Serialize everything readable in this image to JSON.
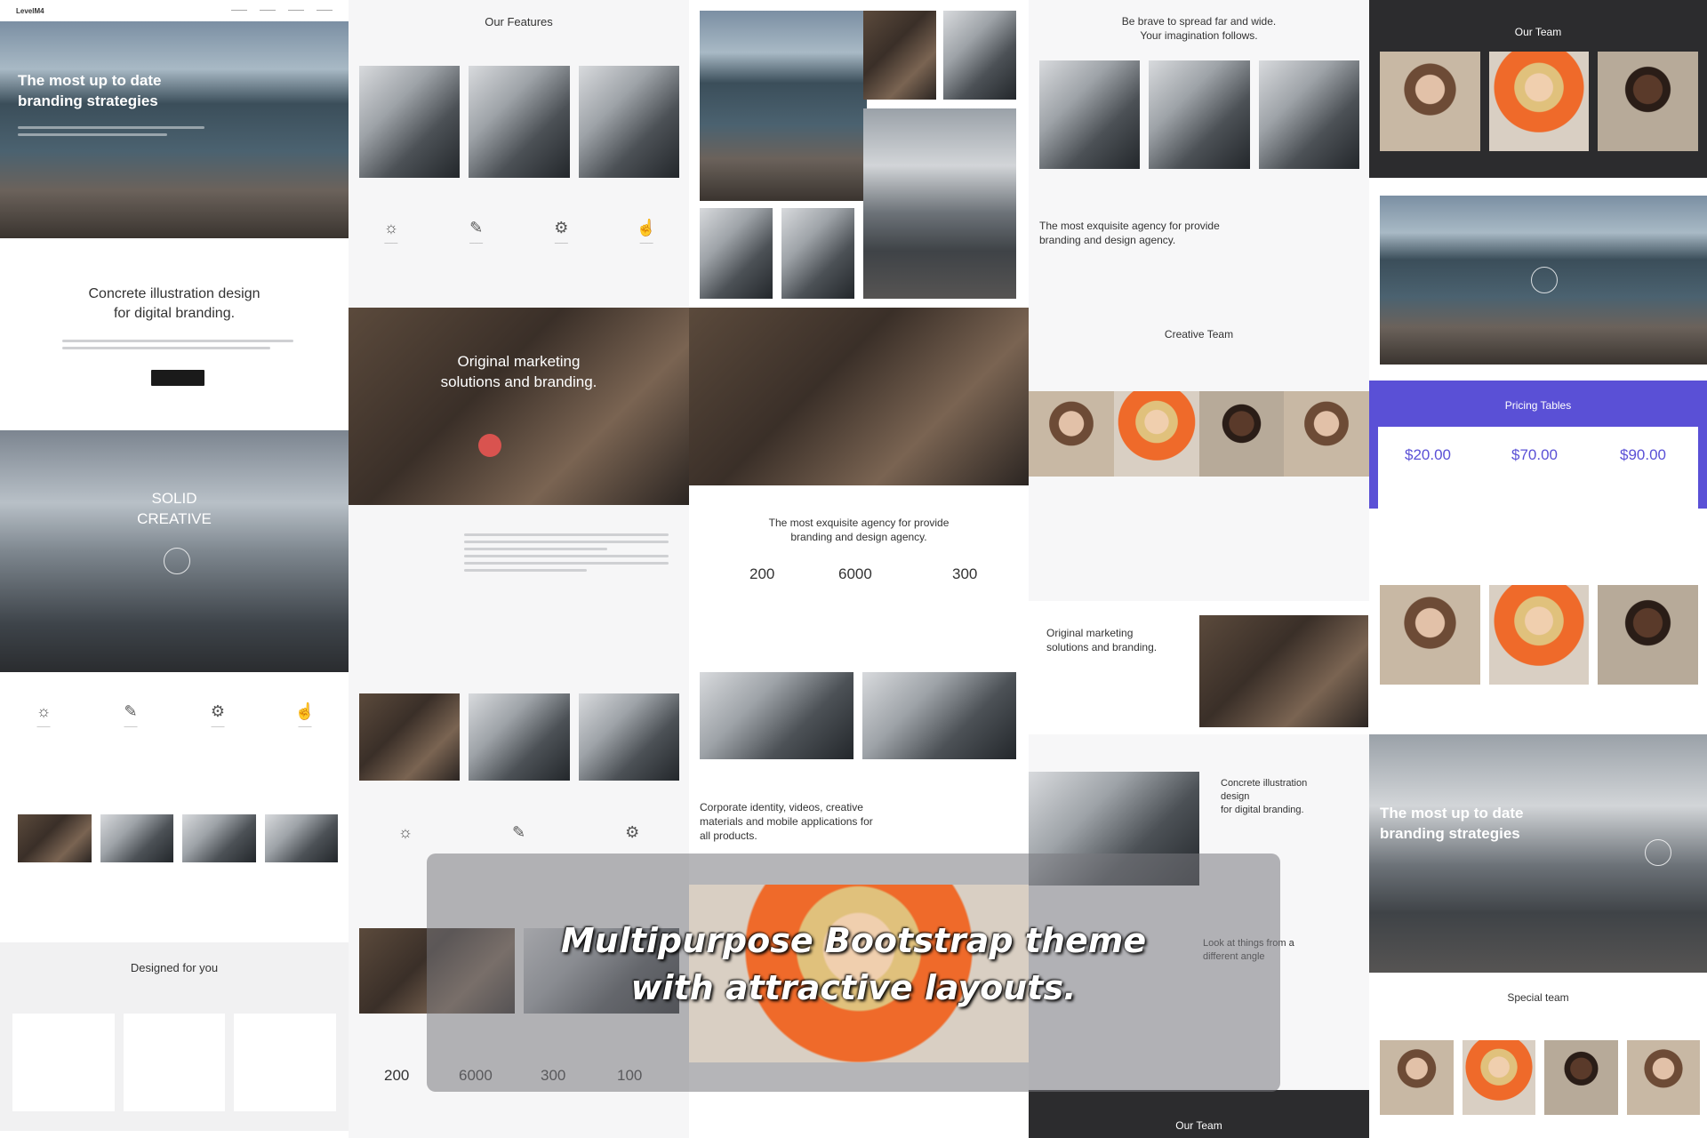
{
  "banner": {
    "line1": "Multipurpose Bootstrap theme",
    "line2": "with attractive layouts."
  },
  "col1": {
    "logo": "LevelM4",
    "hero_title_1": "The most up to date",
    "hero_title_2": "branding strategies",
    "section_title_1": "Concrete illustration design",
    "section_title_2": "for digital branding.",
    "solid_1": "SOLID",
    "solid_2": "CREATIVE",
    "designed": "Designed for you"
  },
  "col2": {
    "features": "Our Features",
    "marketing_1": "Original marketing",
    "marketing_2": "solutions and branding.",
    "stats": [
      "200",
      "6000",
      "300",
      "100"
    ]
  },
  "col3": {
    "agency_1": "The most exquisite agency for provide",
    "agency_2": "branding and design agency.",
    "stats": [
      "200",
      "6000",
      "300"
    ],
    "corporate_1": "Corporate identity, videos, creative",
    "corporate_2": "materials and mobile applications for",
    "corporate_3": "all products."
  },
  "col4": {
    "brave_1": "Be brave to spread far and wide.",
    "brave_2": "Your imagination follows.",
    "agency_1": "The most exquisite agency for provide",
    "agency_2": "branding and design agency.",
    "creative_team": "Creative Team",
    "marketing_1": "Original marketing",
    "marketing_2": "solutions and branding.",
    "concrete_1": "Concrete illustration",
    "concrete_2": "design",
    "concrete_3": "for digital branding.",
    "look_1": "Look at things from a",
    "look_2": "different angle",
    "our_team": "Our Team"
  },
  "col5": {
    "our_team": "Our Team",
    "pricing": "Pricing Tables",
    "prices": [
      "$20.00",
      "$70.00",
      "$90.00"
    ],
    "hero_title_1": "The most up to date",
    "hero_title_2": "branding strategies",
    "special_team": "Special team"
  },
  "colors": {
    "accent_purple": "#5a50d6",
    "dark_section": "#2c2c2e",
    "banner_text": "#ffffff"
  }
}
